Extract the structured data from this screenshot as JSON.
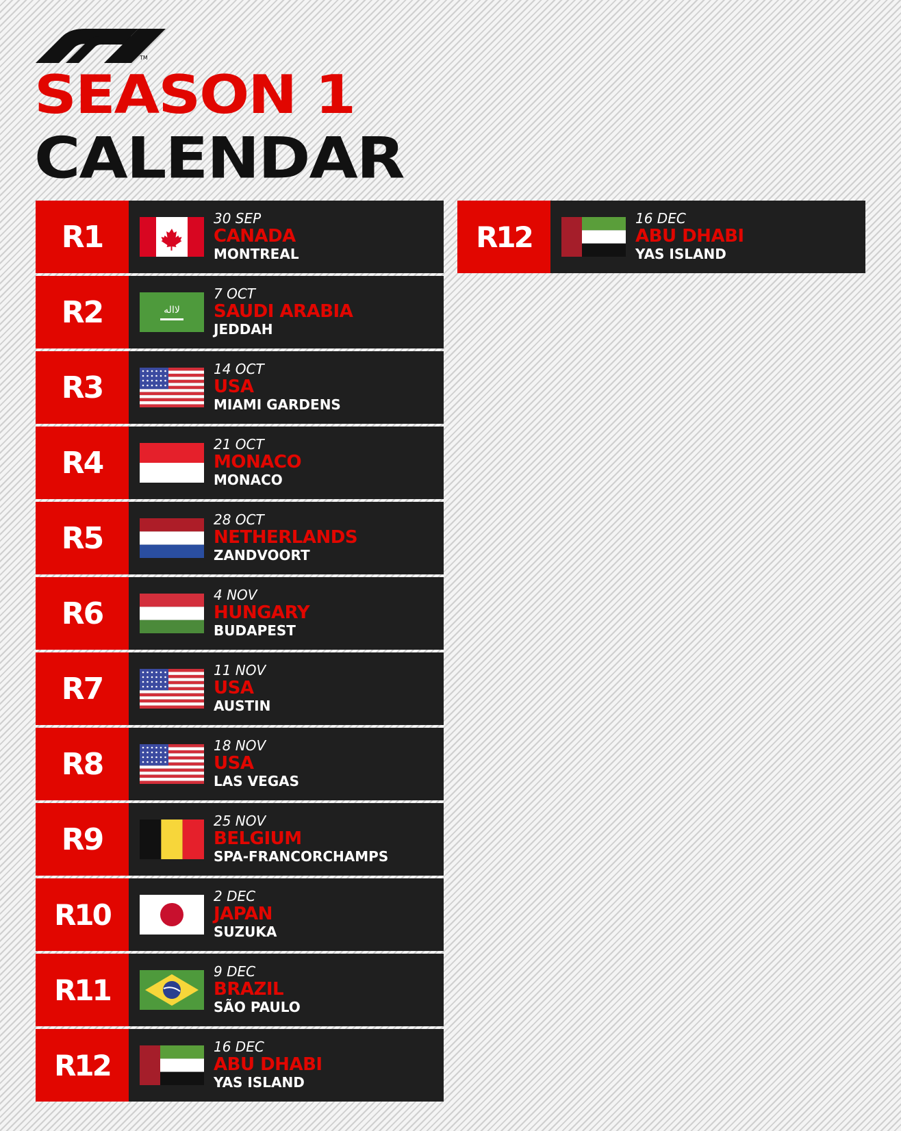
{
  "header": {
    "logo": "F1",
    "trademark": "TM",
    "title_line_1": "SEASON 1",
    "title_line_2": "CALENDAR"
  },
  "colors": {
    "accent_red": "#e10600",
    "row_background": "#1f1f1f",
    "text_white": "#ffffff"
  },
  "races": [
    {
      "round": "R1",
      "date": "30 SEP",
      "country": "CANADA",
      "city": "MONTREAL",
      "flag": "canada-flag"
    },
    {
      "round": "R2",
      "date": "7 OCT",
      "country": "SAUDI ARABIA",
      "city": "JEDDAH",
      "flag": "saudi-arabia-flag"
    },
    {
      "round": "R3",
      "date": "14 OCT",
      "country": "USA",
      "city": "MIAMI GARDENS",
      "flag": "usa-flag"
    },
    {
      "round": "R4",
      "date": "21 OCT",
      "country": "MONACO",
      "city": "MONACO",
      "flag": "monaco-flag"
    },
    {
      "round": "R5",
      "date": "28 OCT",
      "country": "NETHERLANDS",
      "city": "ZANDVOORT",
      "flag": "netherlands-flag"
    },
    {
      "round": "R6",
      "date": "4 NOV",
      "country": "HUNGARY",
      "city": "BUDAPEST",
      "flag": "hungary-flag"
    },
    {
      "round": "R7",
      "date": "11 NOV",
      "country": "USA",
      "city": "AUSTIN",
      "flag": "usa-flag"
    },
    {
      "round": "R8",
      "date": "18 NOV",
      "country": "USA",
      "city": "LAS VEGAS",
      "flag": "usa-flag"
    },
    {
      "round": "R9",
      "date": "25 NOV",
      "country": "BELGIUM",
      "city": "SPA-FRANCORCHAMPS",
      "flag": "belgium-flag"
    },
    {
      "round": "R10",
      "date": "2 DEC",
      "country": "JAPAN",
      "city": "SUZUKA",
      "flag": "japan-flag"
    },
    {
      "round": "R11",
      "date": "9 DEC",
      "country": "BRAZIL",
      "city": "SÃO PAULO",
      "flag": "brazil-flag"
    },
    {
      "round": "R12",
      "date": "16 DEC",
      "country": "ABU DHABI",
      "city": "YAS ISLAND",
      "flag": "uae-flag"
    }
  ],
  "featured": {
    "round": "R12",
    "date": "16 DEC",
    "country": "ABU DHABI",
    "city": "YAS ISLAND",
    "flag": "uae-flag"
  }
}
